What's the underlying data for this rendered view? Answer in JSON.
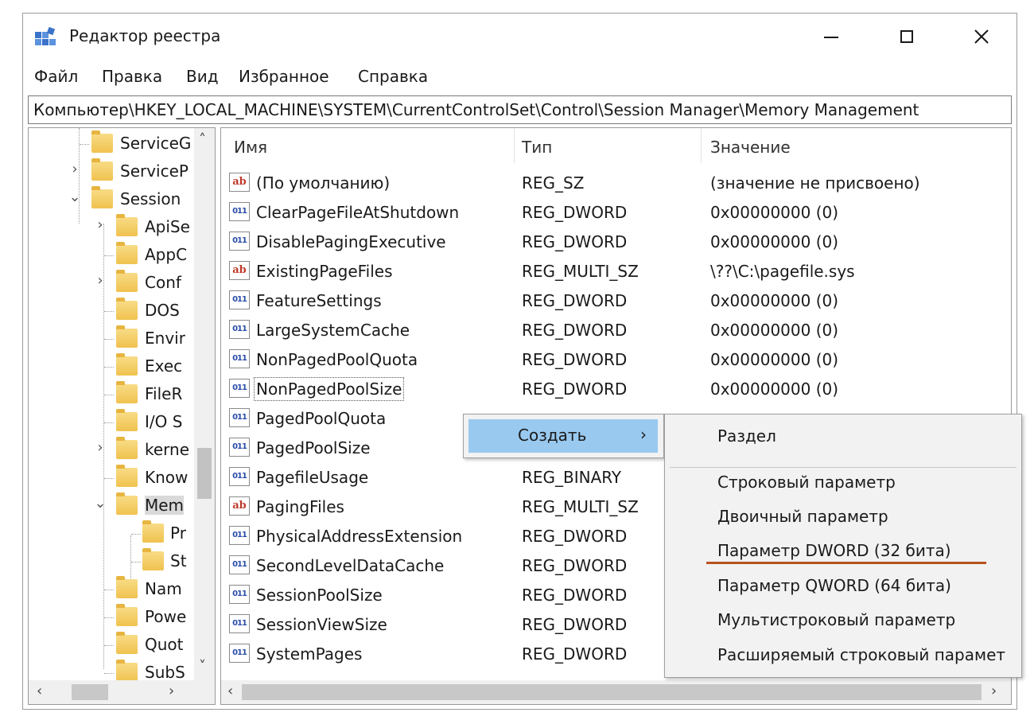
{
  "window": {
    "title": "Редактор реестра",
    "min_glyph": "—",
    "max_glyph": "☐",
    "close_glyph": "✕"
  },
  "menu": [
    "Файл",
    "Правка",
    "Вид",
    "Избранное",
    "Справка"
  ],
  "address": "Компьютер\\HKEY_LOCAL_MACHINE\\SYSTEM\\CurrentControlSet\\Control\\Session Manager\\Memory Management",
  "tree": [
    {
      "label": "ServiceG",
      "twisty": ""
    },
    {
      "label": "ServiceP",
      "twisty": "›"
    },
    {
      "label": "Session",
      "twisty": "⌄"
    },
    {
      "label": "ApiSe",
      "twisty": "›"
    },
    {
      "label": "AppC",
      "twisty": ""
    },
    {
      "label": "Conf",
      "twisty": "›"
    },
    {
      "label": "DOS",
      "twisty": ""
    },
    {
      "label": "Envir",
      "twisty": ""
    },
    {
      "label": "Exec",
      "twisty": ""
    },
    {
      "label": "FileR",
      "twisty": ""
    },
    {
      "label": "I/O S",
      "twisty": ""
    },
    {
      "label": "kerne",
      "twisty": "›"
    },
    {
      "label": "Know",
      "twisty": ""
    },
    {
      "label": "Mem",
      "twisty": "⌄"
    },
    {
      "label": "Pr",
      "twisty": ""
    },
    {
      "label": "St",
      "twisty": ""
    },
    {
      "label": "Nam",
      "twisty": ""
    },
    {
      "label": "Powe",
      "twisty": ""
    },
    {
      "label": "Quot",
      "twisty": ""
    },
    {
      "label": "SubS",
      "twisty": ""
    }
  ],
  "columns": {
    "name": "Имя",
    "type": "Тип",
    "value": "Значение"
  },
  "rows": [
    {
      "icon": "ab",
      "name": "(По умолчанию)",
      "type": "REG_SZ",
      "value": "(значение не присвоено)"
    },
    {
      "icon": "011",
      "name": "ClearPageFileAtShutdown",
      "type": "REG_DWORD",
      "value": "0x00000000 (0)"
    },
    {
      "icon": "011",
      "name": "DisablePagingExecutive",
      "type": "REG_DWORD",
      "value": "0x00000000 (0)"
    },
    {
      "icon": "ab",
      "name": "ExistingPageFiles",
      "type": "REG_MULTI_SZ",
      "value": "\\??\\C:\\pagefile.sys"
    },
    {
      "icon": "011",
      "name": "FeatureSettings",
      "type": "REG_DWORD",
      "value": "0x00000000 (0)"
    },
    {
      "icon": "011",
      "name": "LargeSystemCache",
      "type": "REG_DWORD",
      "value": "0x00000000 (0)"
    },
    {
      "icon": "011",
      "name": "NonPagedPoolQuota",
      "type": "REG_DWORD",
      "value": "0x00000000 (0)"
    },
    {
      "icon": "011",
      "name": "NonPagedPoolSize",
      "type": "REG_DWORD",
      "value": "0x00000000 (0)"
    },
    {
      "icon": "011",
      "name": "PagedPoolQuota",
      "type": "",
      "value": ""
    },
    {
      "icon": "011",
      "name": "PagedPoolSize",
      "type": "",
      "value": ""
    },
    {
      "icon": "011",
      "name": "PagefileUsage",
      "type": "REG_BINARY",
      "value": ""
    },
    {
      "icon": "ab",
      "name": "PagingFiles",
      "type": "REG_MULTI_SZ",
      "value": ""
    },
    {
      "icon": "011",
      "name": "PhysicalAddressExtension",
      "type": "REG_DWORD",
      "value": ""
    },
    {
      "icon": "011",
      "name": "SecondLevelDataCache",
      "type": "REG_DWORD",
      "value": ""
    },
    {
      "icon": "011",
      "name": "SessionPoolSize",
      "type": "REG_DWORD",
      "value": ""
    },
    {
      "icon": "011",
      "name": "SessionViewSize",
      "type": "REG_DWORD",
      "value": ""
    },
    {
      "icon": "011",
      "name": "SystemPages",
      "type": "REG_DWORD",
      "value": ""
    }
  ],
  "context_menu": {
    "create_label": "Создать",
    "create_arrow": "›"
  },
  "submenu": {
    "section": "Раздел",
    "items": [
      "Строковый параметр",
      "Двоичный параметр",
      "Параметр DWORD (32 бита)",
      "Параметр QWORD (64 бита)",
      "Мультистроковый параметр",
      "Расширяемый строковый парамет"
    ]
  },
  "scroll": {
    "left": "‹",
    "right": "›",
    "up": "˄",
    "down": "˅"
  },
  "colors": {
    "menu_highlight": "#99c9ef",
    "annotation_underline": "#b8531e"
  }
}
